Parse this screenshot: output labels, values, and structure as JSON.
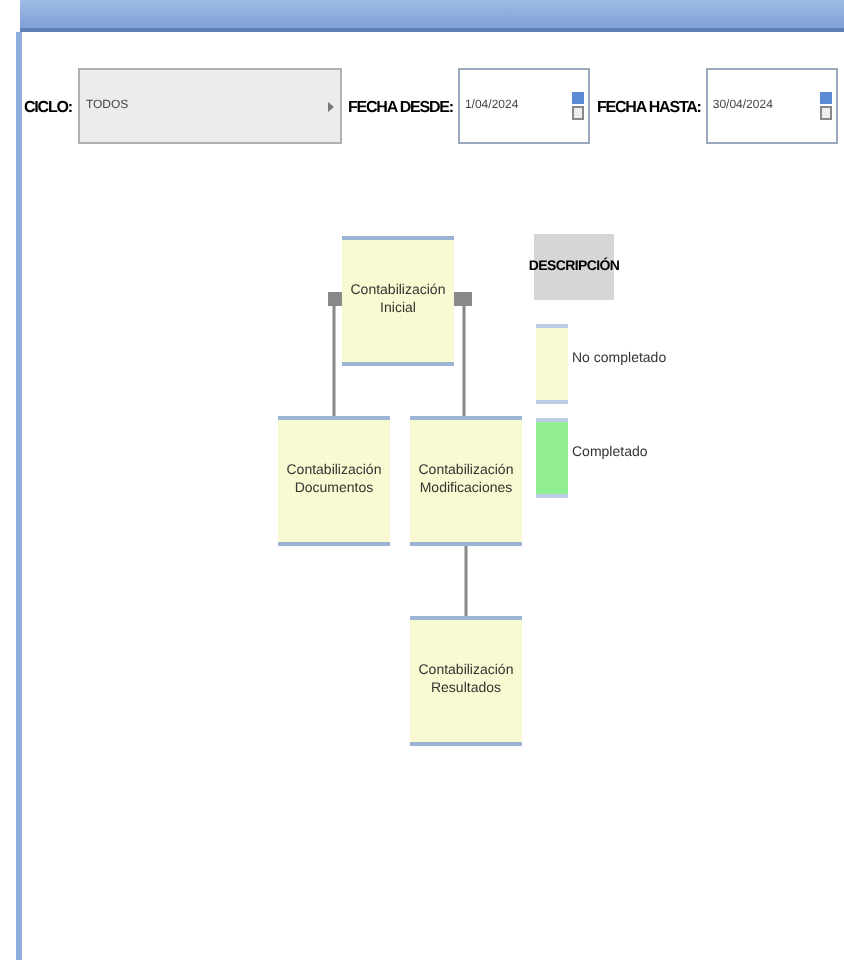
{
  "filters": {
    "cycle": {
      "label": "CICLO:",
      "value": "TODOS"
    },
    "date_from": {
      "label": "FECHA DESDE:",
      "value": "1/04/2024"
    },
    "date_to": {
      "label": "FECHA HASTA:",
      "value": "30/04/2024"
    }
  },
  "diagram": {
    "root": {
      "label": "Contabilización Inicial",
      "completed": false,
      "children": [
        {
          "label": "Contabilización Documentos",
          "completed": false
        },
        {
          "label": "Contabilización Modificaciones",
          "completed": false,
          "children": [
            {
              "label": "Contabilización Resultados",
              "completed": false
            }
          ]
        }
      ]
    }
  },
  "legend": {
    "title": "DESCRIPCIÓN",
    "items": [
      {
        "label": "No completado",
        "completed": false
      },
      {
        "label": "Completado",
        "completed": true
      }
    ]
  }
}
